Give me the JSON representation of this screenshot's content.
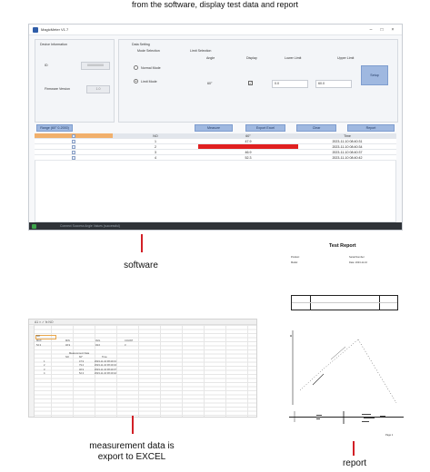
{
  "caption_top": "from the software, display test data and report",
  "window": {
    "title": "MagicMeter V1.7",
    "controls": [
      "–",
      "□",
      "×"
    ]
  },
  "device_info": {
    "title": "Device Information",
    "id_label": "ID",
    "id_value": "000000000",
    "firmware_label": "Firmware Version",
    "firmware_value": "1.0"
  },
  "data_setting": {
    "title": "Data Setting",
    "mode_title": "Mode Selection",
    "mode_options": [
      "Normal Mode",
      "Limit Mode"
    ],
    "limit_title": "Limit Selection",
    "col_angle": "Angle",
    "col_display": "Display",
    "col_lower": "Lower Limit",
    "col_upper": "Upper Limit",
    "angle_value": "60°",
    "lower_value": "0.0",
    "upper_value": "60.0",
    "setup_button": "Setup"
  },
  "actions": {
    "range": "Range (60° 0-2000)",
    "measure": "Measure",
    "export_excel": "Export Excel",
    "clear": "Clear",
    "report": "Report"
  },
  "table": {
    "headers": [
      "",
      "NO",
      "60°",
      "Time"
    ],
    "rows": [
      {
        "no": "1",
        "value": "47.9",
        "time": "2023-11-10 08:40:31",
        "red": false
      },
      {
        "no": "2",
        "value": "",
        "time": "2023-11-10 08:40:34",
        "red": true
      },
      {
        "no": "3",
        "value": "46.9",
        "time": "2023-11-10 08:40:37",
        "red": false
      },
      {
        "no": "4",
        "value": "52.3",
        "time": "2023-11-10 08:40:42",
        "red": false
      }
    ]
  },
  "status": "Connect Success Angle Values (successful)",
  "labels": {
    "software": "software",
    "excel_line1": "measurement data is",
    "excel_line2": "export to EXCEL",
    "report": "report"
  },
  "excel": {
    "bar": "A1  ×  ✓  fx  NO",
    "summary_headers": [
      "NO",
      "MAX",
      "MIN",
      "AVG",
      "COUNT"
    ],
    "summary_values": [
      "60°",
      "52.3",
      "46.9",
      "49.0",
      "3"
    ],
    "detail_title": "Measurement Data",
    "detail_headers": [
      "NO",
      "60°",
      "Time"
    ],
    "detail_rows": [
      [
        "1",
        "47.9",
        "2023-11-10 08:40:31"
      ],
      [
        "2",
        "79.2",
        "2023-11-10 08:40:34"
      ],
      [
        "3",
        "46.9",
        "2023-11-10 08:40:37"
      ],
      [
        "4",
        "52.3",
        "2023-11-10 08:40:42"
      ]
    ]
  },
  "report": {
    "title": "Test Report",
    "meta_left": [
      "Product:",
      "Model:"
    ],
    "meta_right": [
      "Serial Number:",
      "Date: 2023-11-10"
    ],
    "footer": "Page 1"
  }
}
